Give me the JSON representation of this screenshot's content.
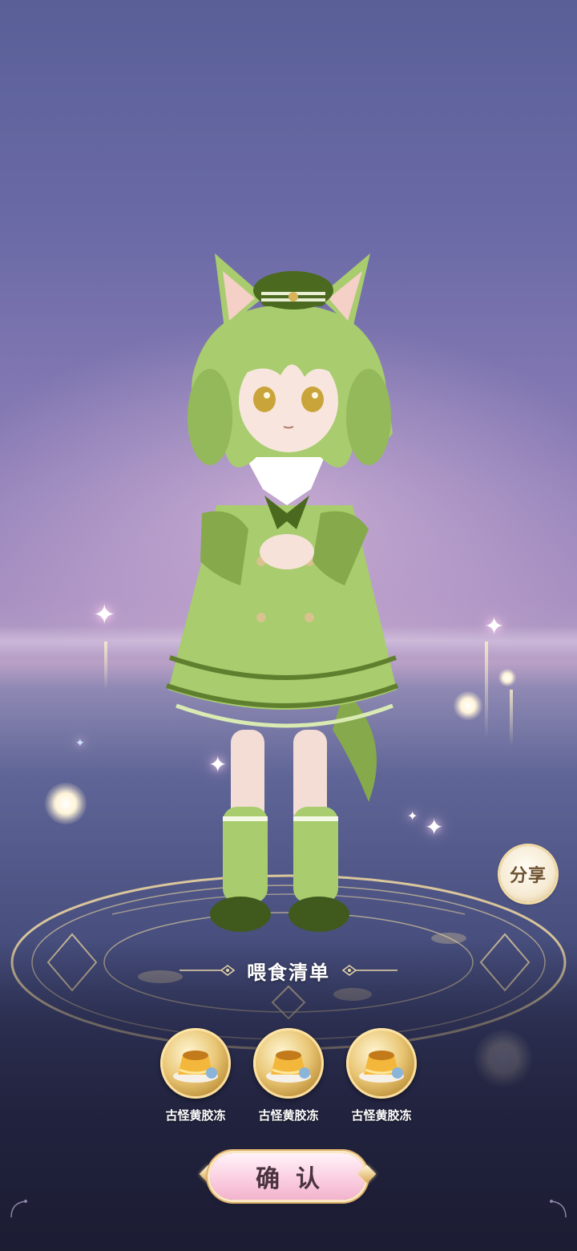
{
  "share_button": {
    "label": "分享",
    "icon": "share"
  },
  "feed_panel": {
    "title": "喂食清单",
    "items": [
      {
        "name": "古怪黄胶冻",
        "icon": "pudding-icon"
      },
      {
        "name": "古怪黄胶冻",
        "icon": "pudding-icon"
      },
      {
        "name": "古怪黄胶冻",
        "icon": "pudding-icon"
      }
    ]
  },
  "confirm_button": {
    "label": "确认"
  },
  "colors": {
    "character_green": "#a8cc6e",
    "character_dark_green": "#5f7f2e",
    "confirm_pink": "#fbd2e3",
    "gold": "#dcb06c"
  }
}
